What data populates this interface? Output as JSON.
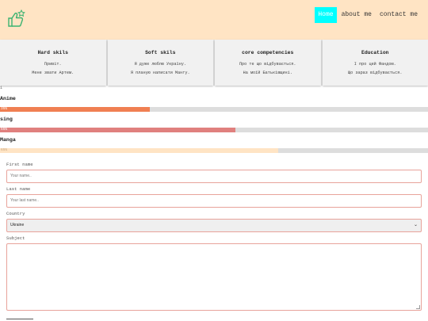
{
  "header": {
    "logo_icon": "thumbs-up-star-icon",
    "nav": [
      {
        "label": "Home",
        "active": true
      },
      {
        "label": "about me",
        "active": false
      },
      {
        "label": "contact me",
        "active": false
      }
    ]
  },
  "cards": [
    {
      "title": "Hard skils",
      "lines": [
        "Привіт.",
        "Мене звати Артем."
      ]
    },
    {
      "title": "Soft skils",
      "lines": [
        "Я дуже люблю Україну.",
        "Я планую написати Мангу."
      ]
    },
    {
      "title": "core competencies",
      "lines": [
        "Про те що відбувається.",
        "На моїй Батьківщині."
      ]
    },
    {
      "title": "Education",
      "lines": [
        "І про цей Фандом.",
        "Що зараз відбувається."
      ]
    }
  ],
  "skills": {
    "marker": "1",
    "items": [
      {
        "name": "Anime",
        "percent_label": "35%",
        "value": 35,
        "color": "#f07f52"
      },
      {
        "name": "sing",
        "percent_label": "55%",
        "value": 55,
        "color": "#e0807e"
      },
      {
        "name": "Manga",
        "percent_label": "65%",
        "value": 65,
        "color": "#ffe4c4"
      }
    ]
  },
  "form": {
    "first_name_label": "First name",
    "first_name_placeholder": "Your name..",
    "last_name_label": "Last name",
    "last_name_placeholder": "Your last name..",
    "country_label": "Country",
    "country_value": "Ukraine",
    "subject_label": "Subject"
  },
  "colors": {
    "header_bg": "#ffe4c4",
    "nav_active_bg": "#00ffff",
    "input_border": "#e8a39b"
  }
}
